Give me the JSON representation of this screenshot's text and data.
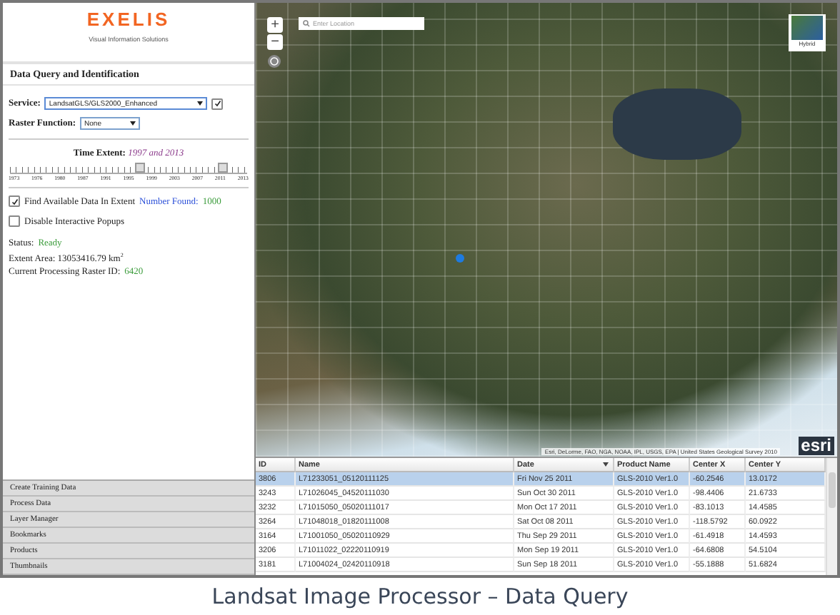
{
  "sidebar": {
    "logo": "EXELIS",
    "tagline": "Visual Information Solutions",
    "section_title": "Data Query and Identification",
    "service": {
      "label": "Service:",
      "value": "LandsatGLS/GLS2000_Enhanced",
      "checked": true
    },
    "raster_function": {
      "label": "Raster Function:",
      "value": "None"
    },
    "time_extent": {
      "label": "Time Extent:",
      "value": "1997 and 2013",
      "ticks": [
        "1973",
        "1976",
        "1980",
        "1987",
        "1991",
        "1995",
        "1999",
        "2003",
        "2007",
        "2011",
        "2013"
      ],
      "thumbs": [
        {
          "level": 0.55
        },
        {
          "level": 0.9
        }
      ]
    },
    "find_available": {
      "label": "Find Available Data In Extent",
      "checked": true,
      "count_label": "Number Found:",
      "count": "1000"
    },
    "disable_popups": {
      "label": "Disable Interactive Popups",
      "checked": false
    },
    "status": {
      "label": "Status:",
      "value": "Ready"
    },
    "extent_area": "Extent Area: 13053416.79 km$^{2}$",
    "raster_id": {
      "label": "Current Processing Raster ID:",
      "value": "6420"
    },
    "panels": [
      "Create Training Data",
      "Process Data",
      "Layer Manager",
      "Bookmarks",
      "Products",
      "Thumbnails"
    ]
  },
  "map": {
    "zoom_in": "+",
    "zoom_out": "−",
    "search": {
      "placeholder": "Enter Location"
    },
    "basemap": "Hybrid",
    "attribution": "Esri, DeLorme, FAO, NGA, NOAA, IPL, USGS, EPA | United States Geological Survey 2010",
    "logo": "esri"
  },
  "table": {
    "columns": [
      {
        "label": "ID",
        "sorted": false
      },
      {
        "label": "Name",
        "sorted": false
      },
      {
        "label": "Date",
        "sorted": true
      },
      {
        "label": "Product Name",
        "sorted": false
      },
      {
        "label": "Center X",
        "sorted": false
      },
      {
        "label": "Center Y",
        "sorted": false
      }
    ],
    "rows": [
      {
        "cells": [
          "3806",
          "L71233051_05120111125",
          "Fri Nov 25 2011",
          "GLS-2010 Ver1.0",
          "-60.2546",
          "13.0172"
        ],
        "selected": true
      },
      {
        "cells": [
          "3243",
          "L71026045_04520111030",
          "Sun Oct 30 2011",
          "GLS-2010 Ver1.0",
          "-98.4406",
          "21.6733"
        ],
        "selected": false
      },
      {
        "cells": [
          "3232",
          "L71015050_05020111017",
          "Mon Oct 17 2011",
          "GLS-2010 Ver1.0",
          "-83.1013",
          "14.4585"
        ],
        "selected": false
      },
      {
        "cells": [
          "3264",
          "L71048018_01820111008",
          "Sat Oct 08 2011",
          "GLS-2010 Ver1.0",
          "-118.5792",
          "60.0922"
        ],
        "selected": false
      },
      {
        "cells": [
          "3164",
          "L71001050_05020110929",
          "Thu Sep 29 2011",
          "GLS-2010 Ver1.0",
          "-61.4918",
          "14.4593"
        ],
        "selected": false
      },
      {
        "cells": [
          "3206",
          "L71011022_02220110919",
          "Mon Sep 19 2011",
          "GLS-2010 Ver1.0",
          "-64.6808",
          "54.5104"
        ],
        "selected": false
      },
      {
        "cells": [
          "3181",
          "L71004024_02420110918",
          "Sun Sep 18 2011",
          "GLS-2010 Ver1.0",
          "-55.1888",
          "51.6824"
        ],
        "selected": false
      }
    ]
  },
  "caption": "Landsat Image Processor – Data Query"
}
